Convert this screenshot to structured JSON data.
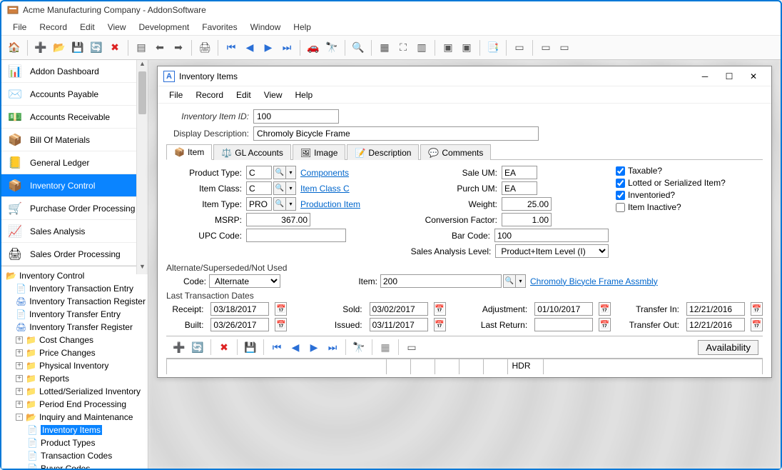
{
  "app": {
    "title": "Acme Manufacturing Company - AddonSoftware"
  },
  "menubar": {
    "file": "File",
    "record": "Record",
    "edit": "Edit",
    "view": "View",
    "development": "Development",
    "favorites": "Favorites",
    "window": "Window",
    "help": "Help"
  },
  "nav": {
    "items": [
      {
        "label": "Addon Dashboard"
      },
      {
        "label": "Accounts Payable"
      },
      {
        "label": "Accounts Receivable"
      },
      {
        "label": "Bill Of Materials"
      },
      {
        "label": "General Ledger"
      },
      {
        "label": "Inventory Control"
      },
      {
        "label": "Purchase Order Processing"
      },
      {
        "label": "Sales Analysis"
      },
      {
        "label": "Sales Order Processing"
      }
    ]
  },
  "tree": {
    "root": "Inventory Control",
    "items": [
      "Inventory Transaction Entry",
      "Inventory Transaction Register",
      "Inventory Transfer Entry",
      "Inventory Transfer Register"
    ],
    "folders": [
      "Cost Changes",
      "Price Changes",
      "Physical Inventory",
      "Reports",
      "Lotted/Serialized Inventory",
      "Period End Processing",
      "Inquiry and Maintenance"
    ],
    "subitems": [
      "Inventory Items",
      "Product Types",
      "Transaction Codes",
      "Buyer Codes"
    ]
  },
  "inner": {
    "title": "Inventory Items",
    "menu": {
      "file": "File",
      "record": "Record",
      "edit": "Edit",
      "view": "View",
      "help": "Help"
    },
    "header": {
      "id_label": "Inventory Item ID:",
      "id_value": "100",
      "desc_label": "Display Description:",
      "desc_value": "Chromoly Bicycle Frame"
    },
    "tabs": {
      "item": "Item",
      "gl": "GL Accounts",
      "image": "Image",
      "desc": "Description",
      "comments": "Comments"
    },
    "left": {
      "product_type_label": "Product Type:",
      "product_type": "C",
      "product_type_link": "Components",
      "item_class_label": "Item Class:",
      "item_class": "C",
      "item_class_link": "Item Class C",
      "item_type_label": "Item Type:",
      "item_type": "PRO",
      "item_type_link": "Production Item",
      "msrp_label": "MSRP:",
      "msrp": "367.00",
      "upc_label": "UPC Code:",
      "upc": ""
    },
    "mid": {
      "sale_um_label": "Sale UM:",
      "sale_um": "EA",
      "purch_um_label": "Purch UM:",
      "purch_um": "EA",
      "weight_label": "Weight:",
      "weight": "25.00",
      "conv_label": "Conversion Factor:",
      "conv": "1.00",
      "barcode_label": "Bar Code:",
      "barcode": "100",
      "sal_label": "Sales Analysis Level:",
      "sal": "Product+Item Level (I)"
    },
    "checks": {
      "taxable": "Taxable?",
      "lotted": "Lotted or Serialized Item?",
      "inventoried": "Inventoried?",
      "inactive": "Item Inactive?"
    },
    "alt": {
      "section": "Alternate/Superseded/Not Used",
      "code_label": "Code:",
      "code": "Alternate",
      "item_label": "Item:",
      "item": "200",
      "item_link": "Chromoly Bicycle Frame Assmbly"
    },
    "dates": {
      "section": "Last Transaction Dates",
      "receipt_label": "Receipt:",
      "receipt": "03/18/2017",
      "built_label": "Built:",
      "built": "03/26/2017",
      "sold_label": "Sold:",
      "sold": "03/02/2017",
      "issued_label": "Issued:",
      "issued": "03/11/2017",
      "adj_label": "Adjustment:",
      "adj": "01/10/2017",
      "ret_label": "Last Return:",
      "ret": "",
      "tin_label": "Transfer In:",
      "tin": "12/21/2016",
      "tout_label": "Transfer Out:",
      "tout": "12/21/2016"
    },
    "availability": "Availability",
    "status": {
      "hdr": "HDR"
    }
  }
}
